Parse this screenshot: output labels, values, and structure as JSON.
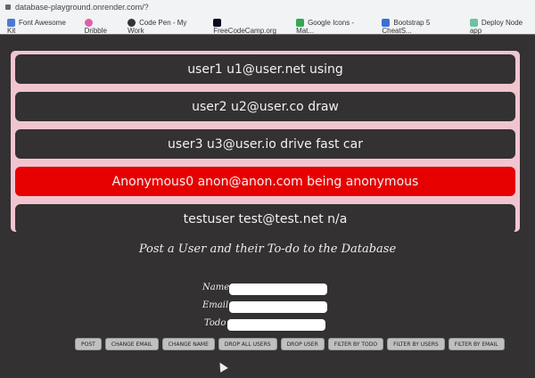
{
  "browser": {
    "url": "database-playground.onrender.com/?",
    "bookmarks": [
      {
        "label": "Font Awesome Kit",
        "color": "#4a7bd0"
      },
      {
        "label": "Dribble",
        "color": "#e05fa8"
      },
      {
        "label": "Code Pen - My Work",
        "color": "#333333"
      },
      {
        "label": "FreeCodeCamp.org",
        "color": "#0a0a23"
      },
      {
        "label": "Google Icons - Mat...",
        "color": "#34a853"
      },
      {
        "label": "Bootstrap 5 CheatS...",
        "color": "#3b6fd4"
      },
      {
        "label": "Deploy Node app",
        "color": "#6fc2a0"
      }
    ]
  },
  "users": [
    {
      "text": "user1 u1@user.net using",
      "highlighted": false
    },
    {
      "text": "user2 u2@user.co draw",
      "highlighted": false
    },
    {
      "text": "user3 u3@user.io drive fast car",
      "highlighted": false
    },
    {
      "text": "Anonymous0 anon@anon.com being anonymous",
      "highlighted": true
    },
    {
      "text": "testuser test@test.net n/a",
      "highlighted": false
    }
  ],
  "form": {
    "heading": "Post a User and their To-do to the Database",
    "name_label": "Name",
    "email_label": "Email",
    "todo_label": "Todo",
    "name_value": "",
    "email_value": "",
    "todo_value": ""
  },
  "buttons": [
    "POST",
    "CHANGE EMAIL",
    "CHANGE NAME",
    "DROP ALL USERS",
    "DROP USER",
    "FILTER BY TODO",
    "FILTER BY USERS",
    "FILTER BY EMAIL"
  ]
}
